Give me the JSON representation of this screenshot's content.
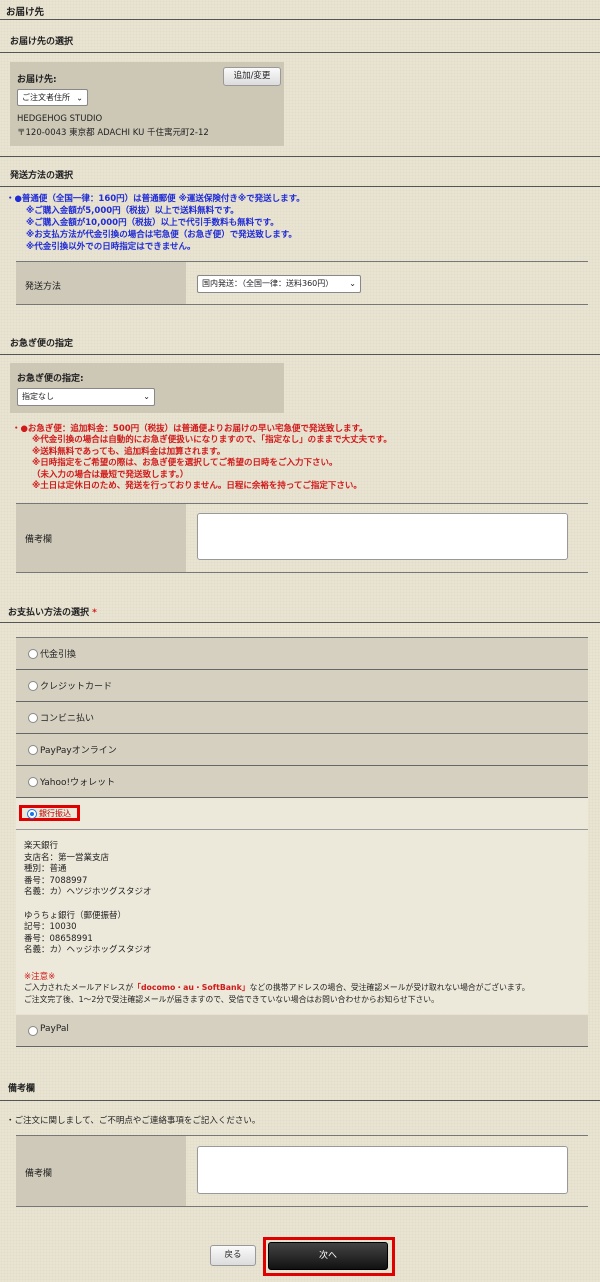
{
  "header": {
    "title": "お届け先"
  },
  "destination": {
    "section_title": "お届け先の選択",
    "label": "お届け先:",
    "button": "追加/変更",
    "select_value": "ご注文者住所",
    "name": "HEDGEHOG STUDIO",
    "address": "〒120-0043 東京都 ADACHI KU 千住寓元町2-12"
  },
  "shipping": {
    "section_title": "発送方法の選択",
    "notes": [
      "・●普通便（全国一律：160円）は普通郵便 ※運送保険付き※で発送します。",
      "※ご購入金額が5,000円（税抜）以上で送料無料です。",
      "※ご購入金額が10,000円（税抜）以上で代引手数料も無料です。",
      "※お支払方法が代金引換の場合は宅急便（お急ぎ便）で発送致します。",
      "※代金引換以外での日時指定はできません。"
    ],
    "method_label": "発送方法",
    "method_value": "国内発送：（全国一律：送料360円）"
  },
  "express": {
    "section_title": "お急ぎ便の指定",
    "label": "お急ぎ便の指定:",
    "select_value": "指定なし",
    "notes": [
      "・●お急ぎ便：追加料金：500円（税抜）は普通便よりお届けの早い宅急便で発送致します。",
      "※代金引換の場合は自動的にお急ぎ便扱いになりますので、「指定なし」のままで大丈夫です。",
      "※送料無料であっても、追加料金は加算されます。",
      "※日時指定をご希望の際は、お急ぎ便を選択してご希望の日時をご入力下さい。",
      "（未入力の場合は最短で発送致します。）",
      "※土日は定休日のため、発送を行っておりません。日程に余裕を持ってご指定下さい。"
    ],
    "remarks_label": "備考欄"
  },
  "payment": {
    "section_title": "お支払い方法の選択",
    "required_mark": "*",
    "options": [
      "代金引換",
      "クレジットカード",
      "コンビニ払い",
      "PayPayオンライン",
      "Yahoo!ウォレット",
      "銀行振込",
      "PayPal"
    ],
    "bank_info": [
      "楽天銀行",
      "支店名：第一営業支店",
      "種別：普通",
      "番号：7088997",
      "名義：カ）ヘツジホツグスタジオ",
      "",
      "ゆうちょ銀行（郵便振替）",
      "記号：10030",
      "番号：08658991",
      "名義：カ）ヘッジホッグスタジオ"
    ],
    "caution_title": "※注意※",
    "caution_line1_pre": "ご入力されたメールアドレスが",
    "caution_line1_em": "「docomo・au・SoftBank」",
    "caution_line1_post": "などの携帯アドレスの場合、受注確認メールが受け取れない場合がございます。",
    "caution_line2": "ご注文完了後、1〜2分で受注確認メールが届きますので、受信できていない場合はお問い合わせからお知らせ下さい。"
  },
  "remarks": {
    "section_title": "備考欄",
    "note": "・ご注文に関しまして、ご不明点やご連絡事項をご記入ください。",
    "label": "備考欄"
  },
  "footer": {
    "back": "戻る",
    "next": "次へ"
  },
  "colors": {
    "highlight": "#e00000",
    "info_blue": "#1f2bd6",
    "info_red": "#d11a1a"
  }
}
